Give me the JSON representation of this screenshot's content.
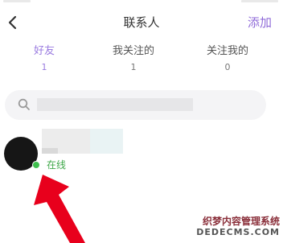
{
  "header": {
    "title": "联系人",
    "add_label": "添加"
  },
  "tabs": [
    {
      "label": "好友",
      "count": "1",
      "active": true
    },
    {
      "label": "我关注的",
      "count": "1",
      "active": false
    },
    {
      "label": "关注我的",
      "count": "0",
      "active": false
    }
  ],
  "contacts": [
    {
      "status": "在线"
    }
  ],
  "watermark": {
    "line1": "织梦内容管理系统",
    "line2": "DEDECMS.COM"
  },
  "colors": {
    "accent": "#9a7be0",
    "online": "#3fbf4e",
    "arrow": "#e8001c"
  }
}
